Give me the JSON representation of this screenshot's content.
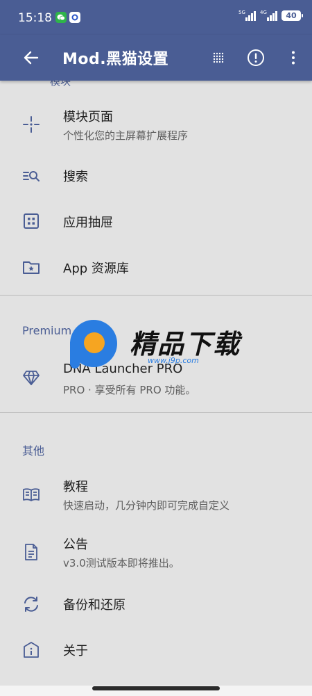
{
  "status_bar": {
    "time": "15:18",
    "app_icons": [
      "wechat-icon",
      "app-notification-icon"
    ],
    "signal_1_label": "5G",
    "signal_2_label": "4G",
    "battery": "40"
  },
  "app_bar": {
    "title": "Mod.黑猫设置",
    "actions": [
      "back-arrow-icon",
      "dots-grid-icon",
      "info-alert-icon",
      "more-vert-icon"
    ]
  },
  "partial_header": "模块",
  "items": [
    {
      "label": "模块页面",
      "sub": "个性化您的主屏幕扩展程序",
      "icon": "crosshair-icon"
    },
    {
      "label": "搜索",
      "icon": "search-list-icon"
    },
    {
      "label": "应用抽屉",
      "icon": "app-drawer-icon"
    },
    {
      "label": "App 资源库",
      "icon": "folder-star-icon"
    }
  ],
  "premium": {
    "header": "Premium",
    "label": "DNA Launcher PRO",
    "sub": "PRO · 享受所有 PRO 功能。",
    "icon": "diamond-icon"
  },
  "other": {
    "header": "其他",
    "items": [
      {
        "label": "教程",
        "sub": "快速启动，几分钟内即可完成自定义",
        "icon": "book-icon"
      },
      {
        "label": "公告",
        "sub": "v3.0测试版本即将推出。",
        "icon": "document-icon"
      },
      {
        "label": "备份和还原",
        "icon": "sync-icon"
      },
      {
        "label": "关于",
        "icon": "info-icon"
      }
    ]
  },
  "watermark": {
    "text": "精品下载",
    "url": "www.j9p.com"
  },
  "colors": {
    "primary": "#4a5d94",
    "background": "#e2e2e2",
    "divider": "#b9b9b9",
    "watermark_blue": "#2a7de1",
    "watermark_orange": "#f6a521"
  }
}
